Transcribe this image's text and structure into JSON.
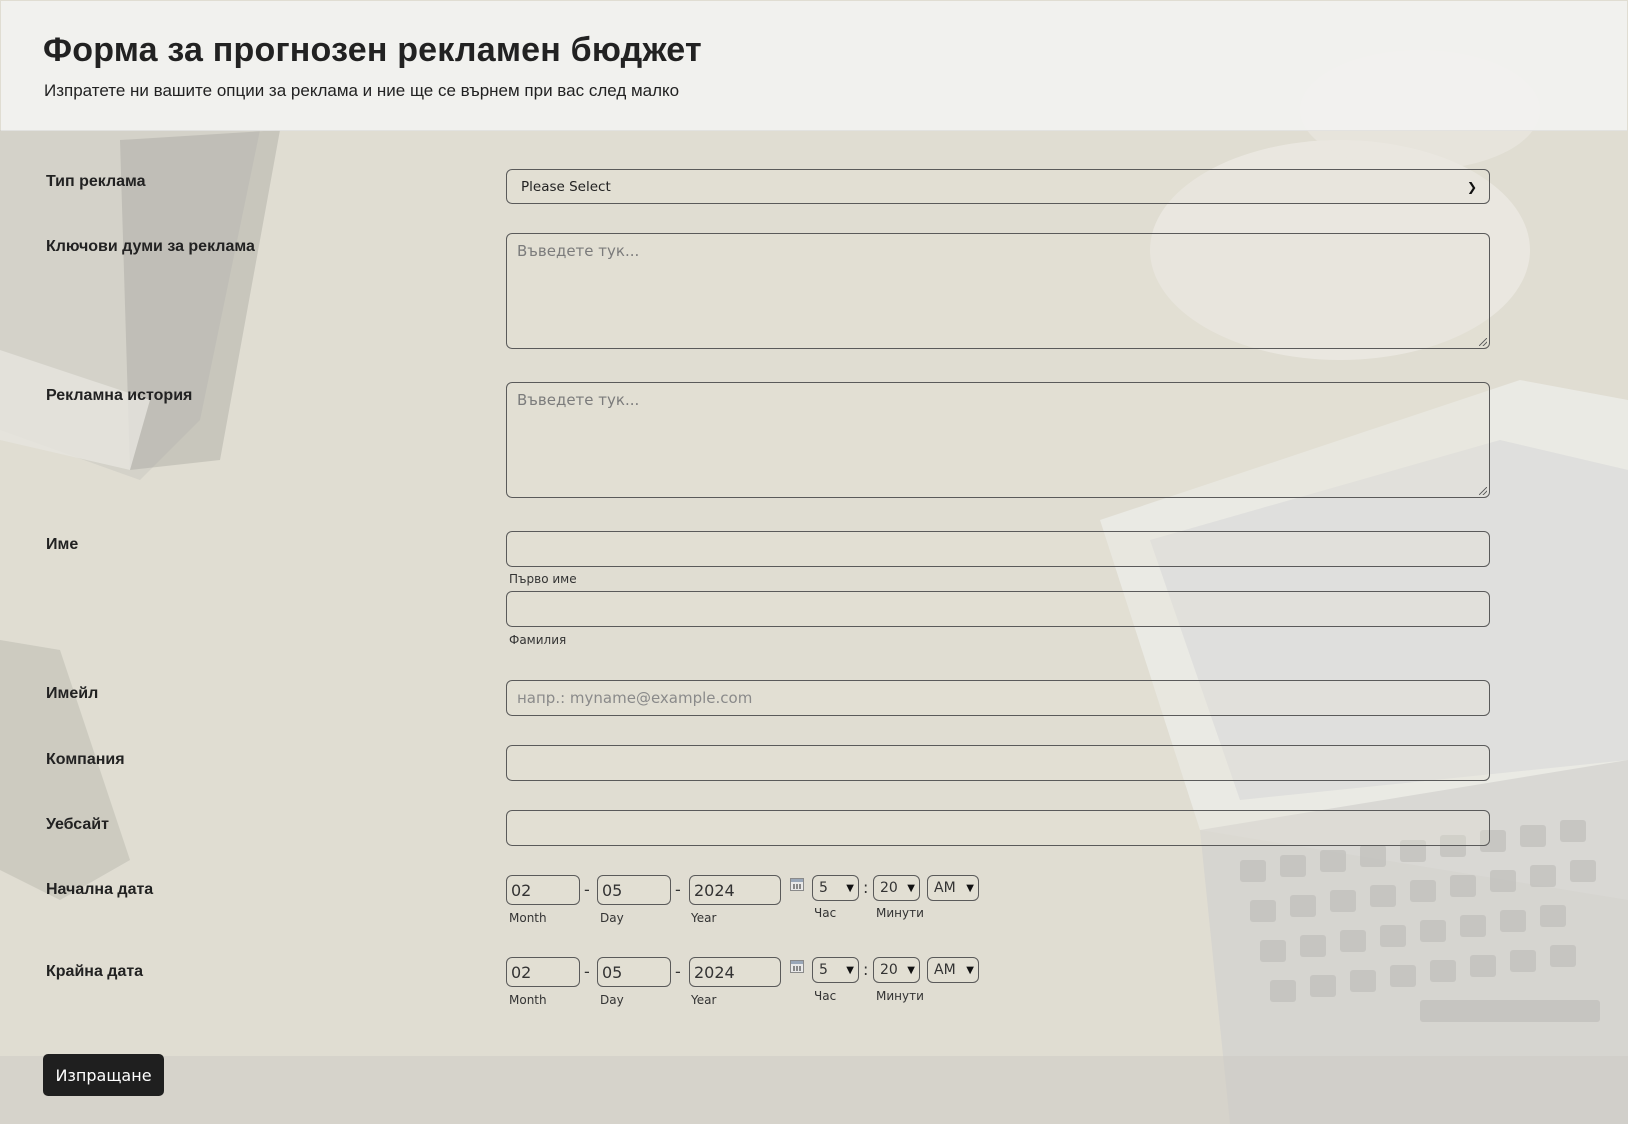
{
  "header": {
    "title": "Форма за прогнозен рекламен бюджет",
    "subtitle": "Изпратете ни вашите опции за реклама и ние ще се върнем при вас след малко"
  },
  "form": {
    "ad_type": {
      "label": "Тип реклама",
      "value": "Please Select"
    },
    "keywords": {
      "label": "Ключови думи за реклама",
      "placeholder": "Въведете тук..."
    },
    "history": {
      "label": "Рекламна история",
      "placeholder": "Въведете тук..."
    },
    "name": {
      "label": "Име",
      "first_sublabel": "Първо име",
      "last_sublabel": "Фамилия"
    },
    "email": {
      "label": "Имейл",
      "placeholder": "напр.: myname@example.com"
    },
    "company": {
      "label": "Компания"
    },
    "website": {
      "label": "Уебсайт"
    },
    "start_date": {
      "label": "Начална дата",
      "month": "02",
      "day": "05",
      "year": "2024",
      "hour": "5",
      "minute": "20",
      "ampm": "AM",
      "month_label": "Month",
      "day_label": "Day",
      "year_label": "Year",
      "hour_label": "Час",
      "minute_label": "Минути"
    },
    "end_date": {
      "label": "Крайна дата",
      "month": "02",
      "day": "05",
      "year": "2024",
      "hour": "5",
      "minute": "20",
      "ampm": "AM",
      "month_label": "Month",
      "day_label": "Day",
      "year_label": "Year",
      "hour_label": "Час",
      "minute_label": "Минути"
    },
    "date_separator": "-",
    "time_separator": ":",
    "submit_label": "Изпращане"
  },
  "icons": {
    "dropdown": "chevron-down-icon",
    "calendar": "calendar-icon"
  },
  "colors": {
    "background": "#dcd9cd",
    "header_bg": "#f2f2f0",
    "button_bg": "#1f1f1f",
    "border": "#5a5a5a"
  }
}
